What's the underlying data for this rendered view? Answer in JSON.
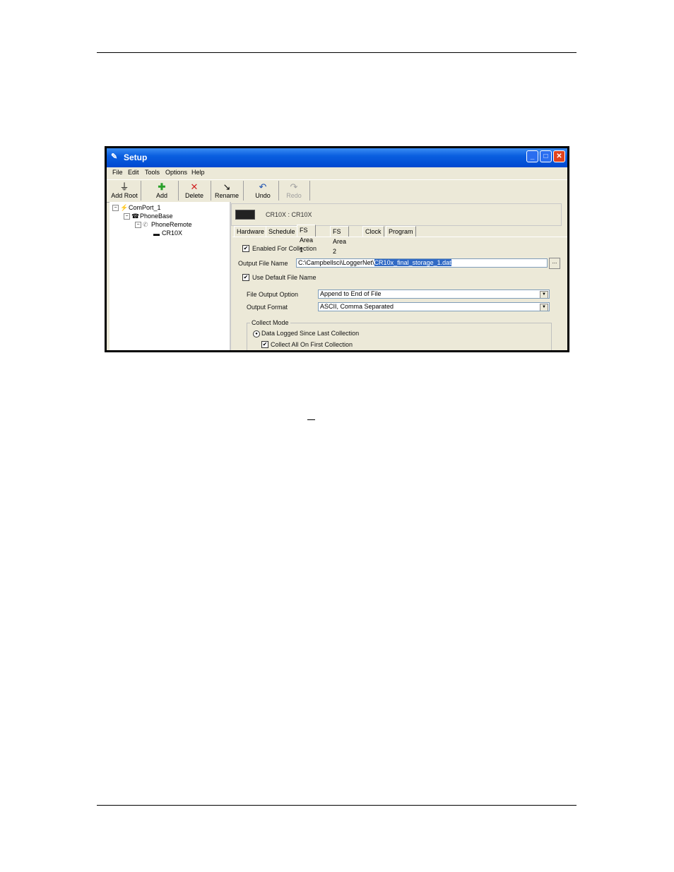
{
  "window": {
    "title": "Setup",
    "buttons": {
      "minimize": "_",
      "maximize": "□",
      "close": "✕"
    }
  },
  "menu": [
    "File",
    "Edit",
    "Tools",
    "Options",
    "Help"
  ],
  "toolbar": {
    "add_root": "Add Root",
    "add": "Add",
    "delete": "Delete",
    "rename": "Rename",
    "undo": "Undo",
    "redo": "Redo"
  },
  "tree": {
    "comport": "ComPort_1",
    "phonebase": "PhoneBase",
    "phoneremote": "PhoneRemote",
    "device": "CR10X"
  },
  "device_header": "CR10X : CR10X",
  "tabs": [
    "Hardware",
    "Schedule",
    "FS Area 1",
    "FS Area 2",
    "Clock",
    "Program"
  ],
  "active_tab": "FS Area 1",
  "form": {
    "enabled_label": "Enabled For Collection",
    "enabled_checked": true,
    "output_file_label": "Output File Name",
    "output_file_path": "C:\\Campbellsci\\LoggerNet\\",
    "output_file_selected": "CR10x_final_storage_1.dat",
    "browse_label": "...",
    "use_default_label": "Use Default File Name",
    "use_default_checked": true,
    "file_output_option_label": "File Output Option",
    "file_output_option_value": "Append to End of File",
    "output_format_label": "Output Format",
    "output_format_value": "ASCII, Comma Separated",
    "collect_mode_label": "Collect Mode",
    "data_logged_label": "Data Logged Since Last Collection",
    "collect_all_label": "Collect All On First Collection",
    "collect_all_checked": true
  },
  "colors": {
    "titlebar": "#0a5fe0",
    "selection": "#316ac5",
    "window_bg": "#ece9d8"
  }
}
